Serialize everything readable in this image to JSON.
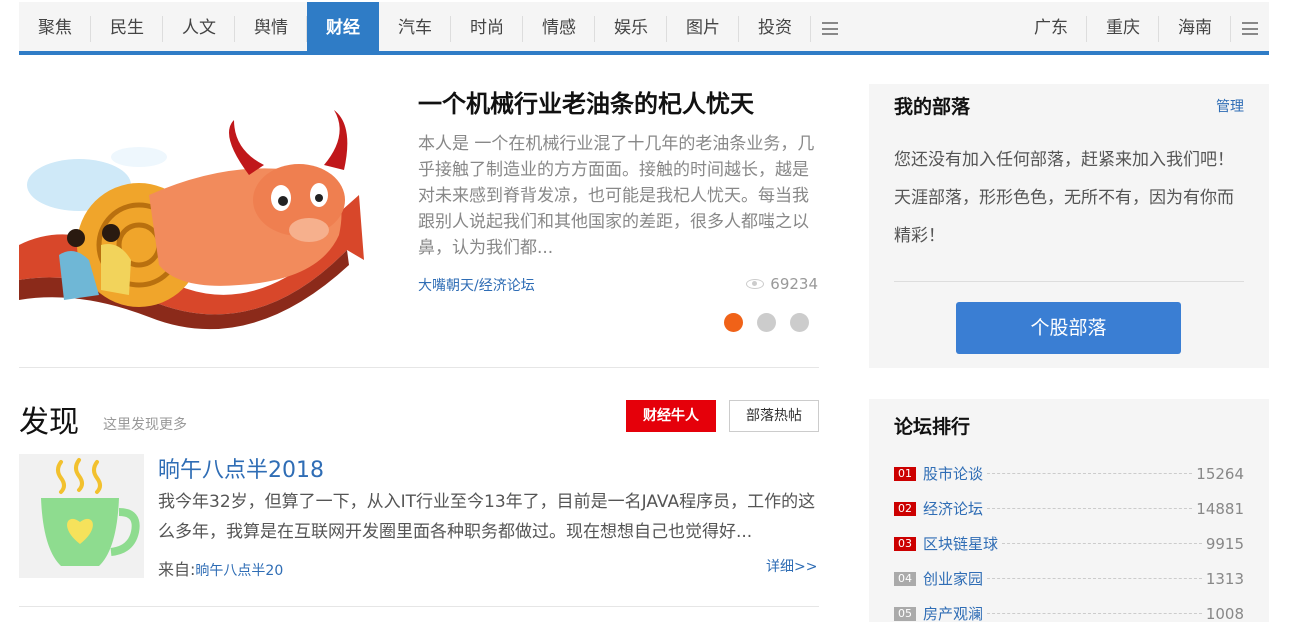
{
  "nav": {
    "left": [
      "聚焦",
      "民生",
      "人文",
      "舆情",
      "财经",
      "汽车",
      "时尚",
      "情感",
      "娱乐",
      "图片",
      "投资"
    ],
    "active": "财经",
    "right": [
      "广东",
      "重庆",
      "海南"
    ],
    "menu_icon": "hamburger-icon",
    "accent_color": "#2f7cc6"
  },
  "featured": {
    "title": "一个机械行业老油条的杞人忧天",
    "summary": "本人是 一个在机械行业混了十几年的老油条业务，几乎接触了制造业的方方面面。接触的时间越长，越是对未来感到脊背发凉，也可能是我杞人忧天。每当我跟别人说起我们和其他国家的差距，很多人都嗤之以鼻，认为我们都...",
    "source": "大嘴朝天/经济论坛",
    "views": "69234",
    "carousel_active_index": 0,
    "carousel_count": 3
  },
  "discover": {
    "title": "发现",
    "subtitle": "这里发现更多",
    "tab_primary": "财经牛人",
    "tab_secondary": "部落热帖",
    "post": {
      "title": "晌午八点半2018",
      "body": "我今年32岁，但算了一下，从入IT行业至今13年了，目前是一名JAVA程序员，工作的这么多年，我算是在互联网开发圈里面各种职务都做过。现在想想自己也觉得好...",
      "from_label": "来自:",
      "from_link": "晌午八点半20",
      "more": "详细>>"
    }
  },
  "tribe": {
    "title": "我的部落",
    "manage": "管理",
    "text": "您还没有加入任何部落，赶紧来加入我们吧！天涯部落，形形色色，无所不有，因为有你而精彩！",
    "button": "个股部落"
  },
  "ranking": {
    "title": "论坛排行",
    "items": [
      {
        "no": "01",
        "name": "股市论谈",
        "value": "15264"
      },
      {
        "no": "02",
        "name": "经济论坛",
        "value": "14881"
      },
      {
        "no": "03",
        "name": "区块链星球",
        "value": "9915"
      },
      {
        "no": "04",
        "name": "创业家园",
        "value": "1313"
      },
      {
        "no": "05",
        "name": "房产观澜",
        "value": "1008"
      }
    ]
  }
}
